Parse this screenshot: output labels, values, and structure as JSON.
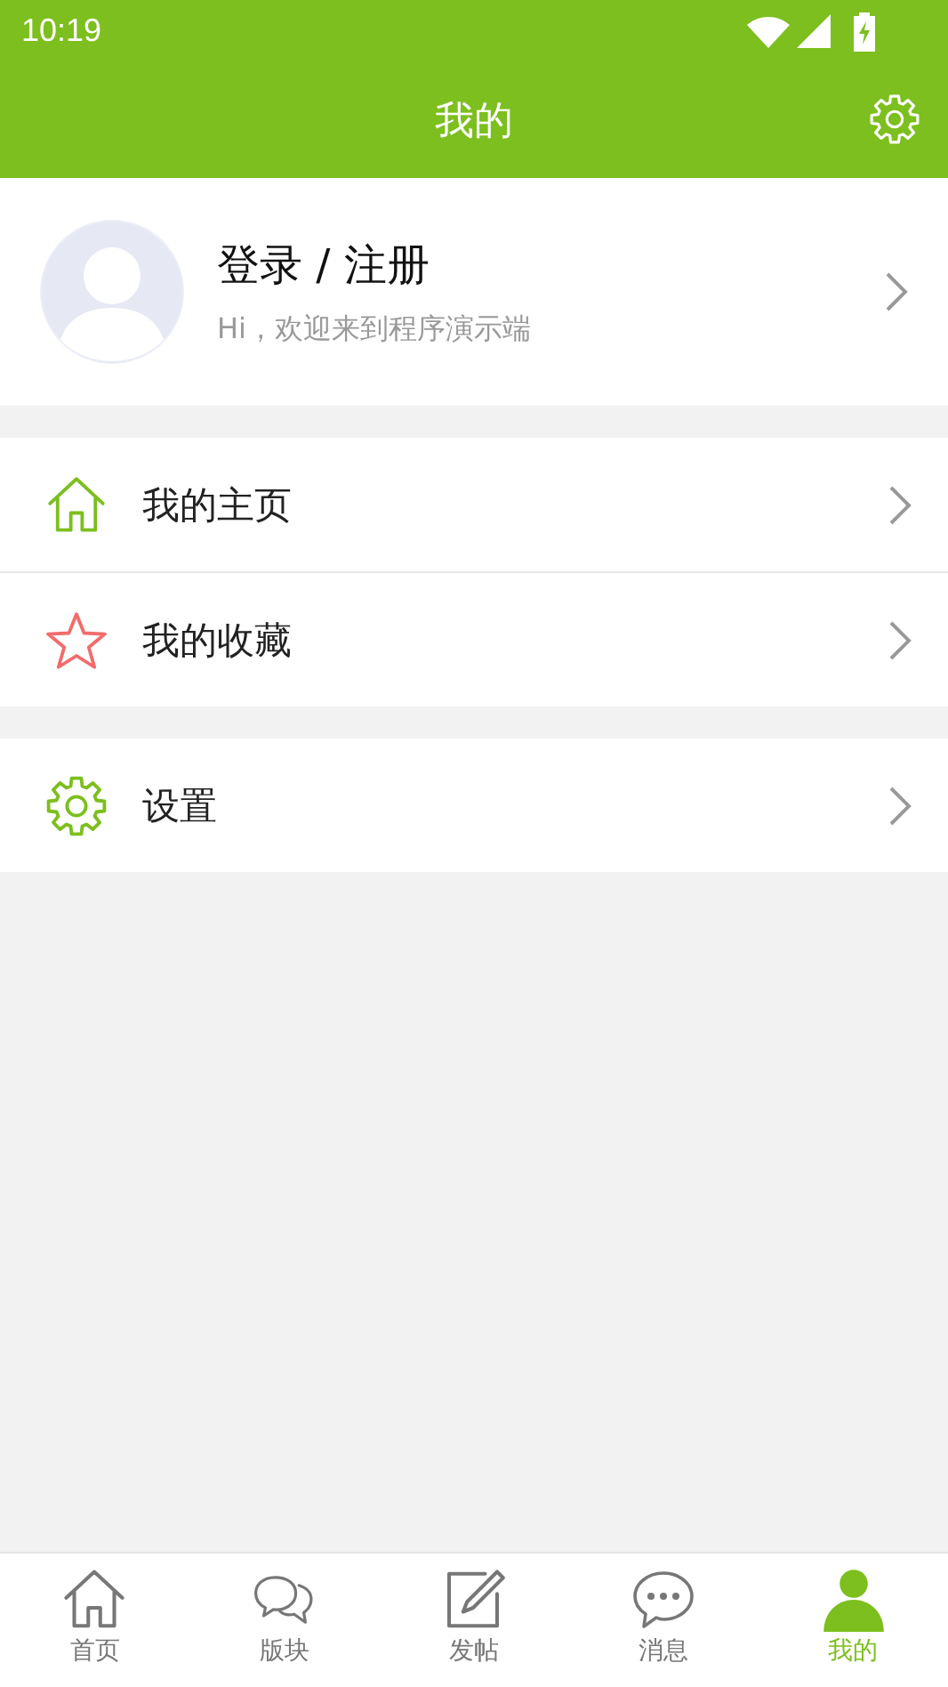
{
  "status_bar": {
    "time": "10:19"
  },
  "header": {
    "title": "我的"
  },
  "profile": {
    "name": "登录 / 注册",
    "subtitle": "Hi，欢迎来到程序演示端"
  },
  "menu_groups": [
    {
      "items": [
        {
          "label": "我的主页",
          "kind": "home"
        },
        {
          "label": "我的收藏",
          "kind": "star"
        }
      ]
    },
    {
      "items": [
        {
          "label": "设置",
          "kind": "gear"
        }
      ]
    }
  ],
  "tabs": [
    {
      "label": "首页",
      "kind": "home",
      "selected": false
    },
    {
      "label": "版块",
      "kind": "chat",
      "selected": false
    },
    {
      "label": "发帖",
      "kind": "edit",
      "selected": false
    },
    {
      "label": "消息",
      "kind": "message",
      "selected": false
    },
    {
      "label": "我的",
      "kind": "user",
      "selected": true
    }
  ]
}
